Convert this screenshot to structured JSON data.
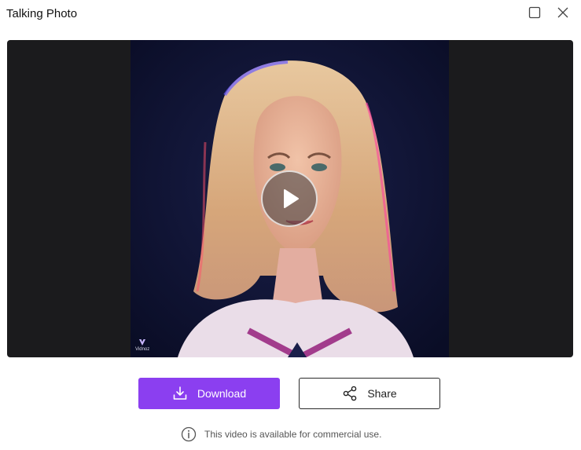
{
  "dialog": {
    "title": "Talking Photo"
  },
  "video": {
    "watermark_text": "Vidnoz"
  },
  "actions": {
    "download_label": "Download",
    "share_label": "Share"
  },
  "notice": {
    "text": "This video is available for commercial use."
  },
  "colors": {
    "accent": "#8b3ff0",
    "video_background": "#1b1b1d"
  },
  "icons": {
    "maximize": "maximize-icon",
    "close": "close-icon",
    "play": "play-icon",
    "download": "download-icon",
    "share": "share-icon",
    "info": "info-icon"
  }
}
